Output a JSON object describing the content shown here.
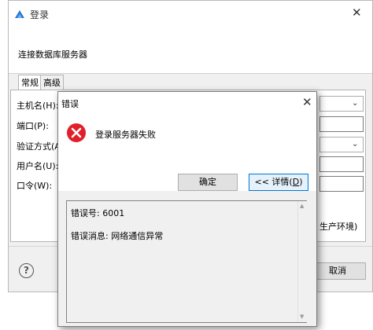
{
  "login_dialog": {
    "title": "登录",
    "header": "连接数据库服务器",
    "close_glyph": "✕",
    "tabs": [
      {
        "label": "常规"
      },
      {
        "label": "高级"
      }
    ],
    "fields": {
      "host": {
        "label": "主机名(H):"
      },
      "port": {
        "label": "端口(P):"
      },
      "auth": {
        "label": "验证方式(A)"
      },
      "user": {
        "label": "用户名(U):"
      },
      "password": {
        "label": "口令(W):"
      }
    },
    "production_label": "生产环境)",
    "help_glyph": "?",
    "cancel_label": "取消"
  },
  "error_dialog": {
    "title": "错误",
    "close_glyph": "✕",
    "message": "登录服务器失败",
    "ok_label": "确定",
    "details_prefix": "<< 详情(",
    "details_key": "D",
    "details_suffix": ")",
    "details": {
      "error_code_line": "错误号:  6001",
      "error_message_line": "错误消息: 网络通信异常"
    }
  },
  "colors": {
    "error_red": "#e0202a",
    "focus_blue": "#0078d7"
  },
  "icons": {
    "app": "app-logo-icon",
    "error": "error-circle-icon",
    "help": "help-icon"
  }
}
